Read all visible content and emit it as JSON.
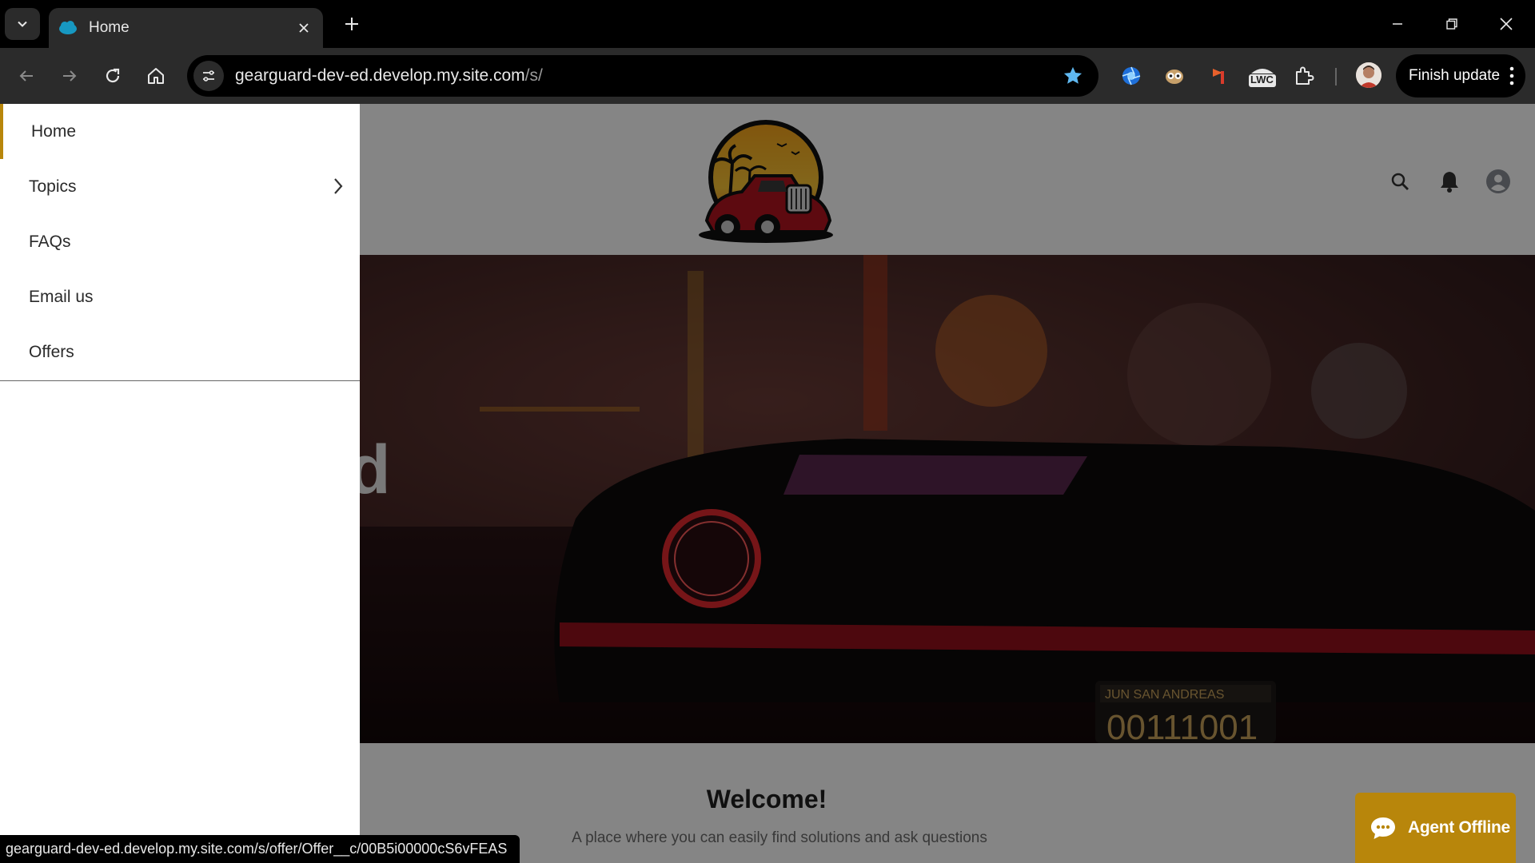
{
  "browser": {
    "tab_title": "Home",
    "url_host": "gearguard-dev-ed.develop.my.site.com",
    "url_path": "/s/",
    "finish_update_label": "Finish update",
    "extension_lwc_label": "LWC",
    "status_url": "gearguard-dev-ed.develop.my.site.com/s/offer/Offer__c/00B5i00000cS6vFEAS"
  },
  "drawer": {
    "items": [
      {
        "label": "Home",
        "active": true
      },
      {
        "label": "Topics",
        "has_submenu": true
      },
      {
        "label": "FAQs"
      },
      {
        "label": "Email us"
      },
      {
        "label": "Offers"
      }
    ],
    "accent_color": "#b8860b"
  },
  "hero": {
    "partial_text": "d",
    "plate_top": "JUN  SAN ANDREAS",
    "plate_number": "00111001"
  },
  "welcome": {
    "title": "Welcome!",
    "subtitle": "A place where you can easily find solutions and ask questions"
  },
  "chat": {
    "label": "Agent Offline",
    "color": "#b8860b"
  }
}
